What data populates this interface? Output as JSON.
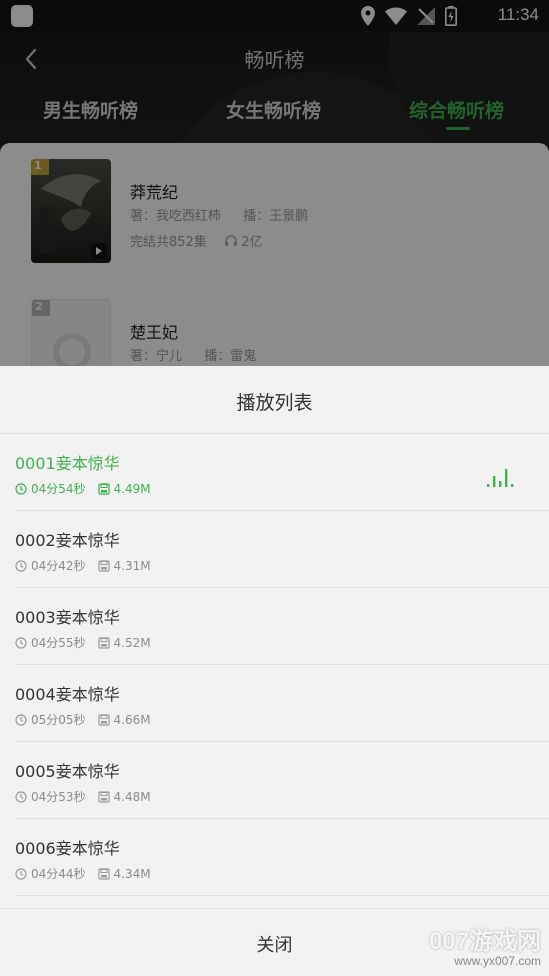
{
  "status_bar": {
    "time": "11:34"
  },
  "header": {
    "title": "畅听榜",
    "tabs": [
      {
        "label": "男生畅听榜",
        "active": false
      },
      {
        "label": "女生畅听榜",
        "active": false
      },
      {
        "label": "综合畅听榜",
        "active": true
      }
    ]
  },
  "books": [
    {
      "rank": "1",
      "title": "莽荒纪",
      "author": "著：我吃西红柿",
      "narrator": "播：王景鹏",
      "episodes": "完结共852集",
      "plays": "2亿"
    },
    {
      "rank": "2",
      "title": "楚王妃",
      "author": "著：宁儿",
      "narrator": "播：雷鬼"
    }
  ],
  "playlist": {
    "title": "播放列表",
    "tracks": [
      {
        "name": "0001妾本惊华",
        "duration": "04分54秒",
        "size": "4.49M",
        "playing": true
      },
      {
        "name": "0002妾本惊华",
        "duration": "04分42秒",
        "size": "4.31M",
        "playing": false
      },
      {
        "name": "0003妾本惊华",
        "duration": "04分55秒",
        "size": "4.52M",
        "playing": false
      },
      {
        "name": "0004妾本惊华",
        "duration": "05分05秒",
        "size": "4.66M",
        "playing": false
      },
      {
        "name": "0005妾本惊华",
        "duration": "04分53秒",
        "size": "4.48M",
        "playing": false
      },
      {
        "name": "0006妾本惊华",
        "duration": "04分44秒",
        "size": "4.34M",
        "playing": false
      }
    ],
    "close_label": "关闭"
  },
  "watermark": {
    "brand": "007游戏网",
    "url": "www.yx007.com"
  },
  "colors": {
    "accent": "#3fb34f",
    "header_bg": "#1c1c1c",
    "sheet_bg": "#f2f2f2"
  }
}
